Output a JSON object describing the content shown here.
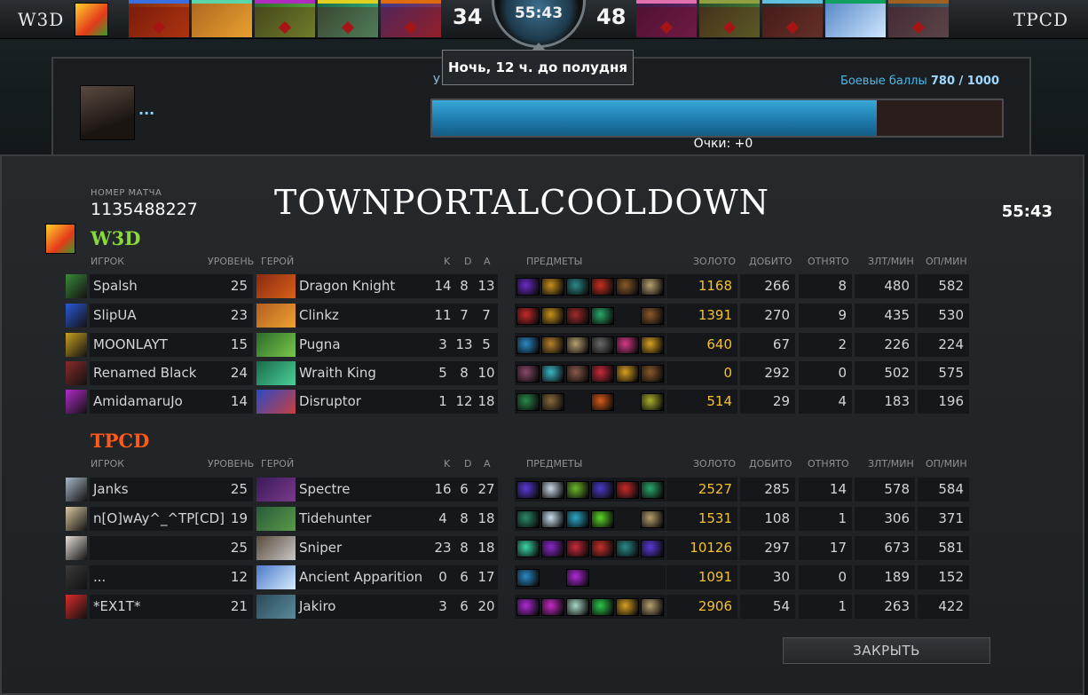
{
  "topbar": {
    "team_left": "W3D",
    "team_right": "TPCD",
    "score_left": "34",
    "score_right": "48",
    "clock": "55:43",
    "tooltip": "Ночь,  12 ч. до полудня",
    "left_heroes": [
      {
        "hero": "Dragon Knight",
        "bar": "#3b6ee0",
        "colors": [
          "#7a2a10",
          "#c8501a"
        ],
        "dead": true
      },
      {
        "hero": "Clinkz",
        "bar": "#5ad6a8",
        "colors": [
          "#b06a20",
          "#e8a030"
        ],
        "dead": false
      },
      {
        "hero": "Pugna",
        "bar": "#b02cc0",
        "colors": [
          "#2c6a2a",
          "#6ac040"
        ],
        "dead": true
      },
      {
        "hero": "Wraith King",
        "bar": "#e0d020",
        "colors": [
          "#1a6a4a",
          "#3ac08a"
        ],
        "dead": true
      },
      {
        "hero": "Disruptor",
        "bar": "#e06a10",
        "colors": [
          "#3a3a8a",
          "#a03040"
        ],
        "dead": true
      }
    ],
    "right_heroes": [
      {
        "hero": "Spectre",
        "bar": "#e070b0",
        "colors": [
          "#3a1a4a",
          "#6a2a6a"
        ],
        "dead": true
      },
      {
        "hero": "Tidehunter",
        "bar": "#90a040",
        "colors": [
          "#2a4a2a",
          "#4a8a3a"
        ],
        "dead": true
      },
      {
        "hero": "Sniper",
        "bar": "#60c0e0",
        "colors": [
          "#2a2a2a",
          "#5a4a3a"
        ],
        "dead": true
      },
      {
        "hero": "Ancient Apparition",
        "bar": "#10a060",
        "colors": [
          "#5a8ac8",
          "#cfe6ff"
        ],
        "dead": false
      },
      {
        "hero": "Jakiro",
        "bar": "#a06020",
        "colors": [
          "#2a4050",
          "#4a6a70"
        ],
        "dead": true
      }
    ]
  },
  "battle_points": {
    "title": "У",
    "label": "Боевые баллы",
    "value": "780 / 1000",
    "fill": 0.78,
    "dots": "...",
    "points": "Очки: +0"
  },
  "board": {
    "match_label": "НОМЕР МАТЧА",
    "match_id": "1135488227",
    "title": "TOWNPORTALCOOLDOWN",
    "time": "55:43",
    "columns": {
      "player": "ИГРОК",
      "level": "УРОВЕНЬ",
      "hero": "ГЕРОЙ",
      "k": "K",
      "d": "D",
      "a": "A",
      "items": "ПРЕДМЕТЫ",
      "gold": "ЗОЛОТО",
      "lh": "ДОБИТО",
      "dn": "ОТНЯТО",
      "gpm": "ЗЛТ/МИН",
      "xpm": "ОП/МИН"
    },
    "close_label": "ЗАКРЫТЬ",
    "teams": [
      {
        "name": "W3D",
        "players": [
          {
            "player": "Spalsh",
            "level": "25",
            "hero": "Dragon Knight",
            "k": "14",
            "d": "8",
            "a": "13",
            "gold": "1168",
            "lh": "266",
            "dn": "8",
            "gpm": "480",
            "xpm": "582",
            "avatar": "#3a8a3a",
            "hero_colors": [
              "#8a2a10",
              "#d8601a"
            ],
            "items": [
              "#6a2ac8",
              "#c8901a",
              "#2a8a8a",
              "#c83020",
              "#8a5a2a",
              "#b8a070"
            ]
          },
          {
            "player": "SlipUA",
            "level": "23",
            "hero": "Clinkz",
            "k": "11",
            "d": "7",
            "a": "7",
            "gold": "1391",
            "lh": "270",
            "dn": "9",
            "gpm": "435",
            "xpm": "530",
            "avatar": "#2a5ad8",
            "hero_colors": [
              "#b06020",
              "#f0a030"
            ],
            "items": [
              "#c82a2a",
              "#c8901a",
              "#a02a2a",
              "#2aa86a",
              "",
              "#8a5a2a"
            ]
          },
          {
            "player": "MOONLAYT",
            "level": "15",
            "hero": "Pugna",
            "k": "3",
            "d": "13",
            "a": "5",
            "gold": "640",
            "lh": "67",
            "dn": "2",
            "gpm": "226",
            "xpm": "224",
            "avatar": "#c8a020",
            "hero_colors": [
              "#2a6a2a",
              "#7ac84a"
            ],
            "items": [
              "#2a8ac8",
              "#b8802a",
              "#b8a070",
              "#6a6a6a",
              "#d83a8a",
              "#d8a020"
            ]
          },
          {
            "player": "Renamed Black Heart",
            "level": "24",
            "hero": "Wraith King",
            "k": "5",
            "d": "8",
            "a": "10",
            "gold": "0",
            "lh": "292",
            "dn": "0",
            "gpm": "502",
            "xpm": "575",
            "avatar": "#8a2a2a",
            "hero_colors": [
              "#1a6a4a",
              "#4ad09a"
            ],
            "items": [
              "#8a4a6a",
              "#3ab8c8",
              "#8a5a4a",
              "#c82a3a",
              "#d8a020",
              "#8a5a2a"
            ]
          },
          {
            "player": "AmidamaruJo",
            "level": "14",
            "hero": "Disruptor",
            "k": "1",
            "d": "12",
            "a": "18",
            "gold": "514",
            "lh": "29",
            "dn": "4",
            "gpm": "183",
            "xpm": "196",
            "avatar": "#b02ac8",
            "hero_colors": [
              "#2a4ac8",
              "#c84040"
            ],
            "items": [
              "#2a8a4a",
              "#8a6a3a",
              "",
              "#d85a1a",
              "",
              "#a8b02a"
            ]
          }
        ]
      },
      {
        "name": "TPCD",
        "players": [
          {
            "player": "Janks",
            "level": "25",
            "hero": "Spectre",
            "k": "16",
            "d": "6",
            "a": "27",
            "gold": "2527",
            "lh": "285",
            "dn": "14",
            "gpm": "578",
            "xpm": "584",
            "avatar": "#a8b8c8",
            "hero_colors": [
              "#3a1a5a",
              "#7a3a8a"
            ],
            "items": [
              "#5a3ad8",
              "#c8d8e8",
              "#6ab82a",
              "#4a3ac8",
              "#c82a2a",
              "#2aa86a"
            ]
          },
          {
            "player": "n[O]wAy^_^TP[CD]",
            "level": "19",
            "hero": "Tidehunter",
            "k": "4",
            "d": "8",
            "a": "18",
            "gold": "1531",
            "lh": "108",
            "dn": "1",
            "gpm": "306",
            "xpm": "371",
            "avatar": "#d8c8a0",
            "hero_colors": [
              "#2a5a3a",
              "#5a9a4a"
            ],
            "items": [
              "#2a8a6a",
              "#c8e0f0",
              "#2aa8c8",
              "#5ad82a",
              "",
              "#b8a070"
            ]
          },
          {
            "player": "",
            "level": "25",
            "hero": "Sniper",
            "k": "23",
            "d": "8",
            "a": "18",
            "gold": "10126",
            "lh": "297",
            "dn": "17",
            "gpm": "673",
            "xpm": "581",
            "avatar": "#e8e0d8",
            "hero_colors": [
              "#5a4a3a",
              "#c8c8c8"
            ],
            "items": [
              "#3ad8a8",
              "#8a2ac8",
              "#c82a3a",
              "#c8302a",
              "#2a8a8a",
              "#5a3ad8"
            ]
          },
          {
            "player": "...",
            "level": "12",
            "hero": "Ancient Apparition",
            "k": "0",
            "d": "6",
            "a": "17",
            "gold": "1091",
            "lh": "30",
            "dn": "0",
            "gpm": "189",
            "xpm": "152",
            "avatar": "#3a3a3a",
            "hero_colors": [
              "#4a7ac8",
              "#d8ecff"
            ],
            "items": [
              "#2a8ac8",
              "",
              "#b02ad8",
              "",
              "",
              ""
            ]
          },
          {
            "player": "*EX1T*",
            "level": "21",
            "hero": "Jakiro",
            "k": "3",
            "d": "6",
            "a": "20",
            "gold": "2906",
            "lh": "54",
            "dn": "1",
            "gpm": "263",
            "xpm": "422",
            "avatar": "#d82a2a",
            "hero_colors": [
              "#2a4a5a",
              "#5a8a9a"
            ],
            "items": [
              "#b02ad8",
              "#c82ac8",
              "#a8d8c8",
              "#2ac84a",
              "#d8a020",
              "#b8a070"
            ]
          }
        ]
      }
    ]
  }
}
